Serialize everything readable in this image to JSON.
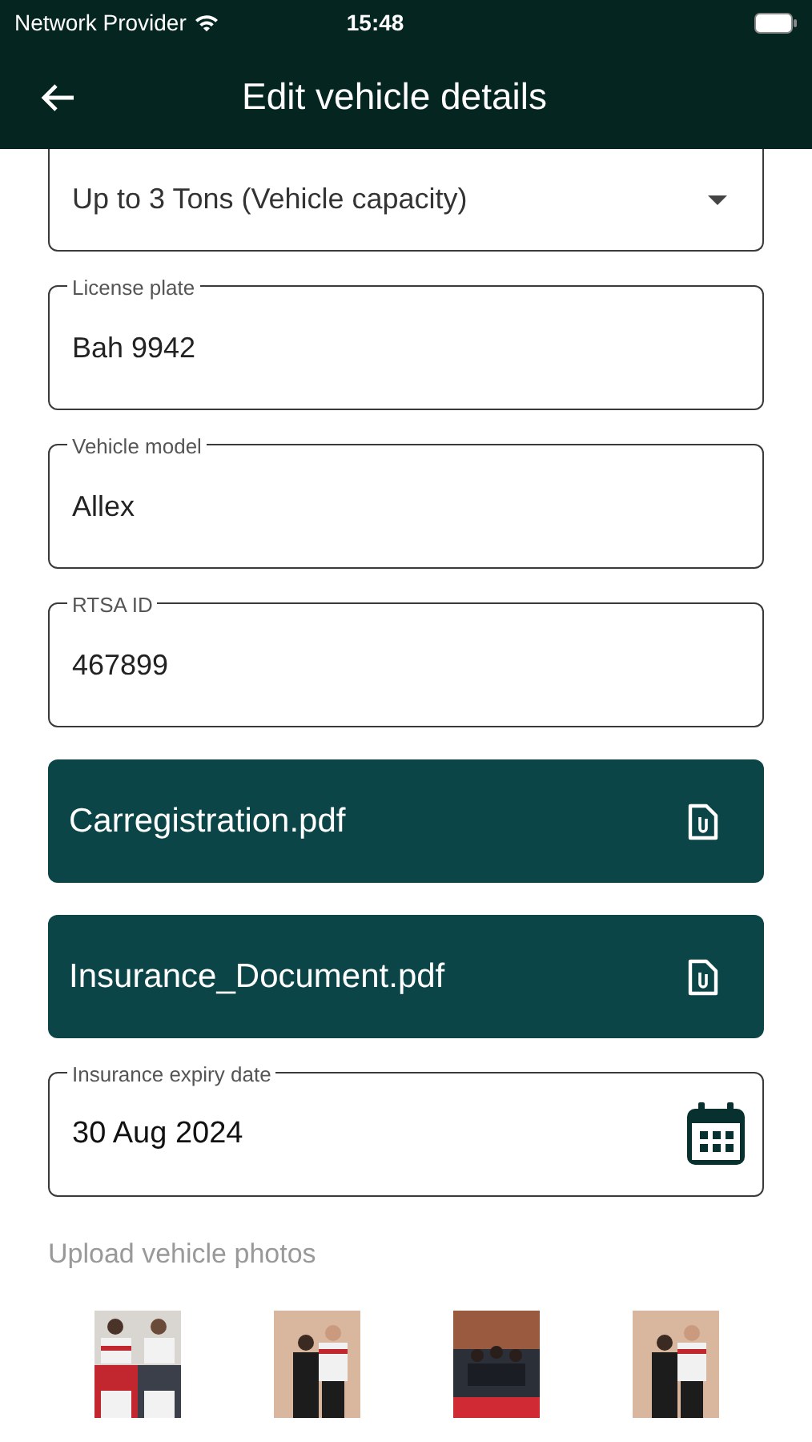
{
  "status_bar": {
    "carrier": "Network Provider",
    "time": "15:48"
  },
  "header": {
    "title": "Edit vehicle details"
  },
  "capacity_select": {
    "value": "Up to 3 Tons (Vehicle capacity)"
  },
  "fields": [
    {
      "label": "License plate",
      "value": "Bah 9942"
    },
    {
      "label": "Vehicle model",
      "value": "Allex"
    },
    {
      "label": "RTSA ID",
      "value": "467899"
    }
  ],
  "documents": [
    {
      "file": "Carregistration.pdf"
    },
    {
      "file": "Insurance_Document.pdf"
    }
  ],
  "expiry_date": {
    "label": "Insurance expiry date",
    "value": "30 Aug 2024"
  },
  "photos": {
    "label": "Upload vehicle photos"
  }
}
